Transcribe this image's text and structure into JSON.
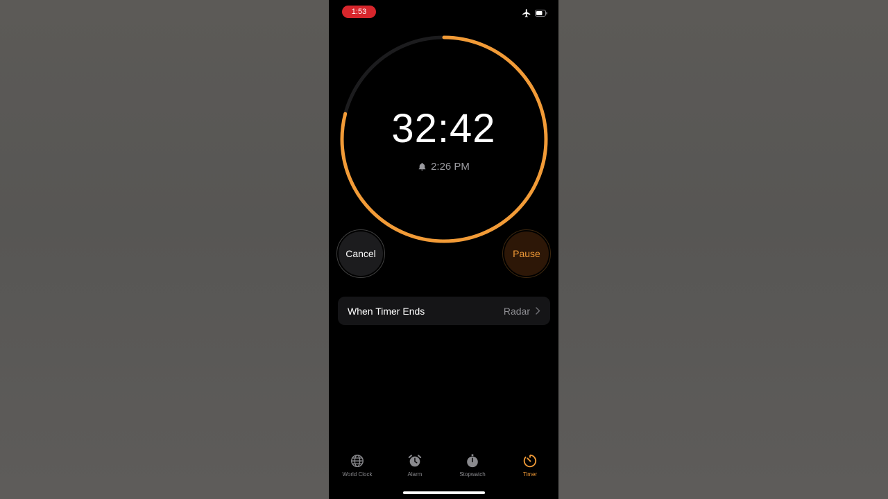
{
  "status_bar": {
    "time": "1:53",
    "airplane_icon": "airplane-icon",
    "battery_icon": "battery-icon"
  },
  "timer": {
    "remaining": "32:42",
    "ends_at": "2:26 PM",
    "progress_fraction": 0.79
  },
  "buttons": {
    "cancel": "Cancel",
    "pause": "Pause"
  },
  "when_timer_ends": {
    "label": "When Timer Ends",
    "value": "Radar"
  },
  "tabs": [
    {
      "label": "World Clock",
      "icon": "globe-icon",
      "active": false
    },
    {
      "label": "Alarm",
      "icon": "alarm-clock-icon",
      "active": false
    },
    {
      "label": "Stopwatch",
      "icon": "stopwatch-icon",
      "active": false
    },
    {
      "label": "Timer",
      "icon": "timer-icon",
      "active": true
    }
  ],
  "colors": {
    "accent": "#f29b37",
    "status_pill": "#d7262c",
    "track": "#1c1c1e"
  }
}
